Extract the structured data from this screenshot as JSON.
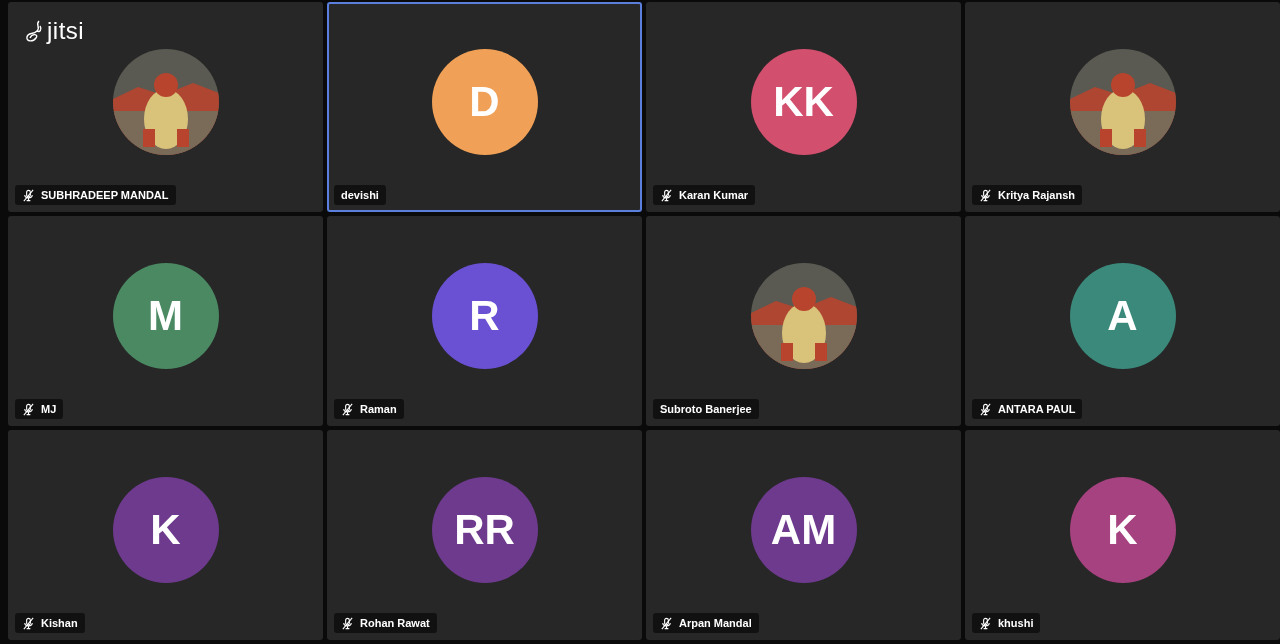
{
  "logo": {
    "text": "jitsi"
  },
  "tiles": [
    {
      "name": "SUBHRADEEP MANDAL",
      "muted": true,
      "selected": false,
      "kind": "picture"
    },
    {
      "name": "devishi",
      "muted": false,
      "selected": true,
      "kind": "initials",
      "initials": "D",
      "color": "#f0a157"
    },
    {
      "name": "Karan Kumar",
      "muted": true,
      "selected": false,
      "kind": "initials",
      "initials": "KK",
      "color": "#d24f6e"
    },
    {
      "name": "Kritya Rajansh",
      "muted": true,
      "selected": false,
      "kind": "picture"
    },
    {
      "name": "MJ",
      "muted": true,
      "selected": false,
      "kind": "initials",
      "initials": "M",
      "color": "#4a8962"
    },
    {
      "name": "Raman",
      "muted": true,
      "selected": false,
      "kind": "initials",
      "initials": "R",
      "color": "#6a50d3"
    },
    {
      "name": "Subroto Banerjee",
      "muted": false,
      "selected": false,
      "kind": "picture"
    },
    {
      "name": "ANTARA PAUL",
      "muted": true,
      "selected": false,
      "kind": "initials",
      "initials": "A",
      "color": "#3b897b"
    },
    {
      "name": "Kishan",
      "muted": true,
      "selected": false,
      "kind": "initials",
      "initials": "K",
      "color": "#6d3a8d"
    },
    {
      "name": "Rohan Rawat",
      "muted": true,
      "selected": false,
      "kind": "initials",
      "initials": "RR",
      "color": "#6d3a8d"
    },
    {
      "name": "Arpan Mandal",
      "muted": true,
      "selected": false,
      "kind": "initials",
      "initials": "AM",
      "color": "#6d3a8d"
    },
    {
      "name": "khushi",
      "muted": true,
      "selected": false,
      "kind": "initials",
      "initials": "K",
      "color": "#a5427f"
    }
  ]
}
